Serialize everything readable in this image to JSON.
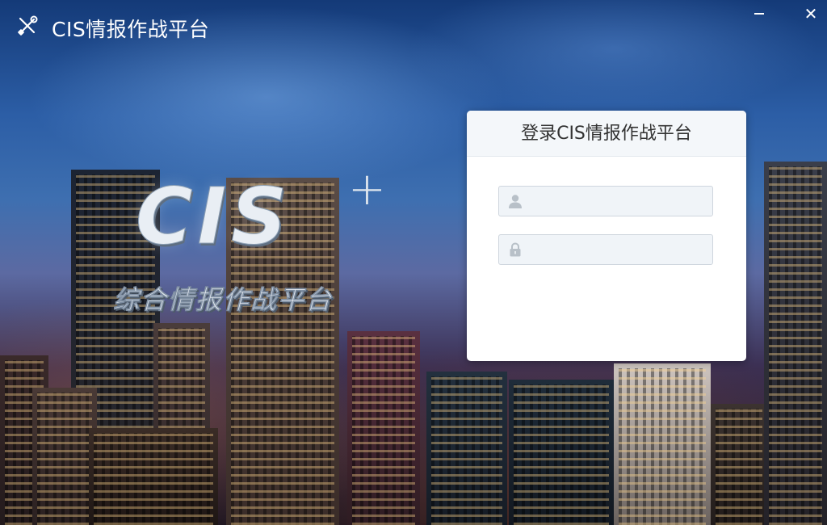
{
  "window": {
    "title": "CIS情报作战平台",
    "app_icon": "tools-icon",
    "controls": {
      "minimize_icon": "minimize-icon",
      "close_label": "✕"
    }
  },
  "hero": {
    "logo_text": "CIS",
    "logo_plus": "+",
    "subtitle": "综合情报作战平台"
  },
  "login": {
    "title": "登录CIS情报作战平台",
    "username": {
      "value": "",
      "placeholder": "",
      "icon": "user-icon"
    },
    "password": {
      "value": "",
      "placeholder": "",
      "icon": "lock-icon"
    }
  },
  "colors": {
    "card_background": "#ffffff",
    "header_background": "#f4f7fa",
    "field_background": "#f0f4f8",
    "field_border": "#cfd6de",
    "icon_color": "#b8c0c8",
    "title_text": "#333333"
  }
}
